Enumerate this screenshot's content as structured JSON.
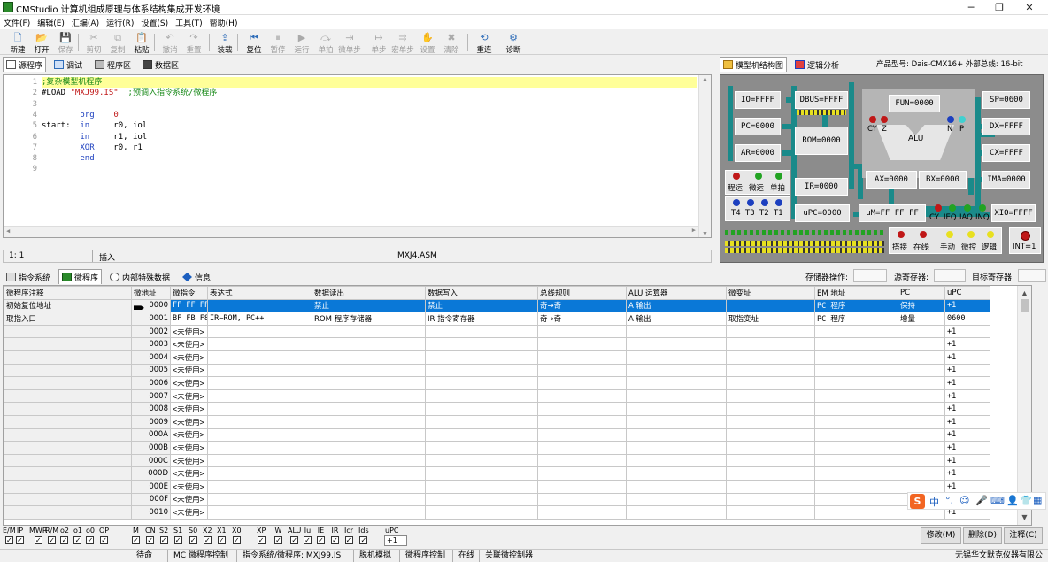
{
  "window": {
    "title": "CMStudio 计算机组成原理与体系结构集成开发环境"
  },
  "menu": [
    "文件(F)",
    "编辑(E)",
    "汇编(A)",
    "运行(R)",
    "设置(S)",
    "工具(T)",
    "帮助(H)"
  ],
  "toolbar": [
    {
      "label": "新建",
      "icon": "new-file-icon",
      "glyph": "🗋",
      "enabled": true
    },
    {
      "label": "打开",
      "icon": "open-folder-icon",
      "glyph": "📂",
      "enabled": true
    },
    {
      "label": "保存",
      "icon": "save-icon",
      "glyph": "💾",
      "enabled": false
    },
    {
      "label": "剪切",
      "icon": "cut-icon",
      "glyph": "✂",
      "enabled": false
    },
    {
      "label": "复制",
      "icon": "copy-icon",
      "glyph": "⧉",
      "enabled": false
    },
    {
      "label": "粘贴",
      "icon": "paste-icon",
      "glyph": "📋",
      "enabled": true
    },
    {
      "label": "撤消",
      "icon": "undo-icon",
      "glyph": "↶",
      "enabled": false
    },
    {
      "label": "重置",
      "icon": "redo-icon",
      "glyph": "↷",
      "enabled": false
    },
    {
      "label": "装载",
      "icon": "load-icon",
      "glyph": "⇪",
      "enabled": true
    },
    {
      "label": "复位",
      "icon": "reset-icon",
      "glyph": "⏮",
      "enabled": true
    },
    {
      "label": "暂停",
      "icon": "pause-icon",
      "glyph": "⏸",
      "enabled": false
    },
    {
      "label": "运行",
      "icon": "run-icon",
      "glyph": "▶",
      "enabled": false
    },
    {
      "label": "单拍",
      "icon": "single-beat-icon",
      "glyph": "⤼",
      "enabled": false
    },
    {
      "label": "微单步",
      "icon": "micro-step-icon",
      "glyph": "⇥",
      "enabled": false
    },
    {
      "label": "单步",
      "icon": "step-icon",
      "glyph": "↦",
      "enabled": false
    },
    {
      "label": "宏单步",
      "icon": "macro-step-icon",
      "glyph": "⇉",
      "enabled": false
    },
    {
      "label": "设置",
      "icon": "breakpoint-icon",
      "glyph": "✋",
      "enabled": false
    },
    {
      "label": "清除",
      "icon": "clear-breakpoint-icon",
      "glyph": "✖",
      "enabled": false
    },
    {
      "label": "重连",
      "icon": "reconnect-icon",
      "glyph": "⟲",
      "enabled": true
    },
    {
      "label": "诊断",
      "icon": "diagnose-icon",
      "glyph": "⚙",
      "enabled": true
    }
  ],
  "editor_tabs": [
    "源程序",
    "调试",
    "程序区",
    "数据区"
  ],
  "editor": {
    "lines": [
      {
        "n": "1",
        "text": ";复杂模型机程序"
      },
      {
        "n": "2",
        "text": "#LOAD \"MXJ99.IS\"  ;预调入指令系统/微程序"
      },
      {
        "n": "3",
        "text": ""
      },
      {
        "n": "4",
        "text": "        org    0"
      },
      {
        "n": "5",
        "text": "start:  in     r0, iol"
      },
      {
        "n": "6",
        "text": "        in     r1, iol"
      },
      {
        "n": "7",
        "text": "        XOR    r0, r1"
      },
      {
        "n": "8",
        "text": "        end"
      },
      {
        "n": "9",
        "text": ""
      }
    ],
    "status_pos": "1:  1",
    "status_mode": "插入",
    "status_file": "MXJ4.ASM"
  },
  "right_tabs": [
    "模型机结构图",
    "逻辑分析"
  ],
  "product": "产品型号: Dais-CMX16+  外部总线: 16-bit",
  "diagram": {
    "registers": {
      "io": "IO=FFFF",
      "dbus": "DBUS=FFFF",
      "fun": "FUN=0000",
      "sp": "SP=0600",
      "pc": "PC=0000",
      "rom": "ROM=0000",
      "dx": "DX=FFFF",
      "ar": "AR=0000",
      "alu": "ALU",
      "cx": "CX=FFFF",
      "ax": "AX=0000",
      "bx": "BX=0000",
      "ir": "IR=0000",
      "ima": "IMA=0000",
      "upc": "uPC=0000",
      "um": "uM=FF FF FF",
      "xio": "XIO=FFFF",
      "int": "INT=1"
    },
    "labels": {
      "cy": "CY",
      "z": "Z",
      "n": "N",
      "p": "P",
      "run": "程运",
      "micro_run": "微运",
      "single": "单拍",
      "t4": "T4",
      "t3": "T3",
      "t2": "T2",
      "t1": "T1",
      "cy2": "CY",
      "ieq": "IEQ",
      "iaq": "IAQ",
      "inq": "INQ",
      "bus_hold": "搭接",
      "online": "在线",
      "manual": "手动",
      "micro_ctrl": "微控",
      "logic": "逻辑"
    },
    "colors": {
      "bg": "#8c8c8c",
      "bus": "#1a8a8a",
      "red": "#c01818",
      "green": "#22a322",
      "blue": "#1c3fbf",
      "cyan": "#40d0d0",
      "yellow": "#e8e020"
    }
  },
  "bottom_tabs": [
    "指令系统",
    "微程序",
    "内部特殊数据",
    "信息"
  ],
  "bottom_fields": {
    "mem_op": "存储器操作:",
    "src_reg": "源寄存器:",
    "dst_reg": "目标寄存器:"
  },
  "grid": {
    "headers": [
      "微程序注释",
      "微地址",
      "微指令",
      "表达式",
      "数据读出",
      "数据写入",
      "总线规则",
      "ALU 运算器",
      "微变址",
      "EM 地址",
      "PC",
      "uPC"
    ],
    "rows": [
      [
        "初始复位地址",
        "0000",
        "FF FF FF",
        "",
        "禁止",
        "禁止",
        "奇→奇",
        "A 输出",
        "",
        "PC 程序",
        "保持",
        "+1"
      ],
      [
        "取指入口",
        "0001",
        "BF FB F8",
        "IR←ROM, PC++",
        "ROM 程序存储器",
        "IR 指令寄存器",
        "奇→奇",
        "A 输出",
        "取指变址",
        "PC 程序",
        "增量",
        "0600"
      ],
      [
        "",
        "0002",
        "<未使用>",
        "",
        "",
        "",
        "",
        "",
        "",
        "",
        "",
        "+1"
      ],
      [
        "",
        "0003",
        "<未使用>",
        "",
        "",
        "",
        "",
        "",
        "",
        "",
        "",
        "+1"
      ],
      [
        "",
        "0004",
        "<未使用>",
        "",
        "",
        "",
        "",
        "",
        "",
        "",
        "",
        "+1"
      ],
      [
        "",
        "0005",
        "<未使用>",
        "",
        "",
        "",
        "",
        "",
        "",
        "",
        "",
        "+1"
      ],
      [
        "",
        "0006",
        "<未使用>",
        "",
        "",
        "",
        "",
        "",
        "",
        "",
        "",
        "+1"
      ],
      [
        "",
        "0007",
        "<未使用>",
        "",
        "",
        "",
        "",
        "",
        "",
        "",
        "",
        "+1"
      ],
      [
        "",
        "0008",
        "<未使用>",
        "",
        "",
        "",
        "",
        "",
        "",
        "",
        "",
        "+1"
      ],
      [
        "",
        "0009",
        "<未使用>",
        "",
        "",
        "",
        "",
        "",
        "",
        "",
        "",
        "+1"
      ],
      [
        "",
        "000A",
        "<未使用>",
        "",
        "",
        "",
        "",
        "",
        "",
        "",
        "",
        "+1"
      ],
      [
        "",
        "000B",
        "<未使用>",
        "",
        "",
        "",
        "",
        "",
        "",
        "",
        "",
        "+1"
      ],
      [
        "",
        "000C",
        "<未使用>",
        "",
        "",
        "",
        "",
        "",
        "",
        "",
        "",
        "+1"
      ],
      [
        "",
        "000D",
        "<未使用>",
        "",
        "",
        "",
        "",
        "",
        "",
        "",
        "",
        "+1"
      ],
      [
        "",
        "000E",
        "<未使用>",
        "",
        "",
        "",
        "",
        "",
        "",
        "",
        "",
        "+1"
      ],
      [
        "",
        "000F",
        "<未使用>",
        "",
        "",
        "",
        "",
        "",
        "",
        "",
        "",
        "+1"
      ],
      [
        "",
        "0010",
        "<未使用>",
        "",
        "",
        "",
        "",
        "",
        "",
        "",
        "",
        "+1"
      ]
    ]
  },
  "flags": [
    "E/M",
    "IP",
    "MWR",
    "R/M",
    "o2",
    "o1",
    "o0",
    "OP",
    "M",
    "CN",
    "S2",
    "S1",
    "S0",
    "X2",
    "X1",
    "X0",
    "XP",
    "W",
    "ALU",
    "Iu",
    "IE",
    "IR",
    "Icr",
    "Ids",
    "uPC"
  ],
  "upc_value": "+1",
  "buttons": {
    "modify": "修改(M)",
    "delete": "删除(D)",
    "comment": "注释(C)"
  },
  "statusbar": [
    "待命",
    "MC 微程序控制",
    "指令系统/微程序: MXJ99.IS",
    "脱机模拟",
    "微程序控制",
    "在线",
    "关联微控制器"
  ],
  "company": "无锡华文默克仪器有限公司",
  "ime": {
    "logo": "S",
    "chars": [
      "中",
      "°,",
      "☺",
      "🎤",
      "⌨",
      "👤",
      "👕",
      "▦"
    ]
  }
}
